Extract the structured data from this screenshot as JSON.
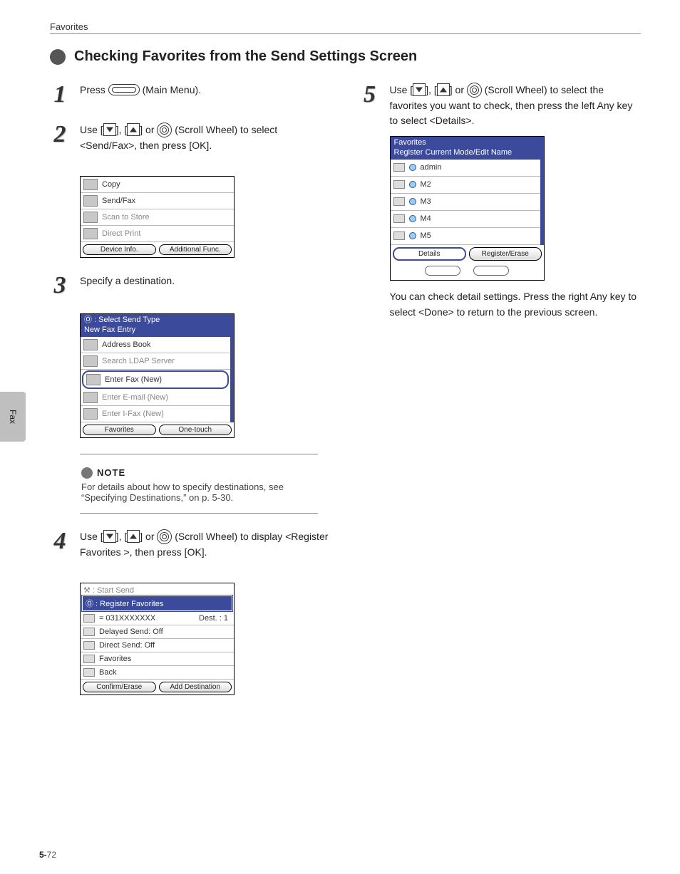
{
  "running_header": "Favorites",
  "section_title": "Checking Favorites from the Send Settings Screen",
  "sidetab": "Fax",
  "page_number_bold": "5-",
  "page_number_rest": "72",
  "steps": {
    "s1": {
      "num": "1",
      "text_a": "Press ",
      "text_b": " (Main Menu)."
    },
    "s2": {
      "num": "2",
      "text_a": "Use [",
      "text_b": "], [",
      "text_c": "] or ",
      "text_d": " (Scroll Wheel) to select <Send/Fax>, then press [OK]."
    },
    "s3": {
      "num": "3",
      "text": "Specify a destination."
    },
    "s4": {
      "num": "4",
      "text_a": "Use [",
      "text_b": "], [",
      "text_c": "] or ",
      "text_d": " (Scroll Wheel) to display <Register Favorites >, then press [OK]."
    },
    "s5": {
      "num": "5",
      "text_a": "Use [",
      "text_b": "], [",
      "text_c": "] or ",
      "text_d": " (Scroll Wheel) to select the favorites you want to check, then press the left Any key to select <Details>.",
      "below_text": "You can check detail settings. Press the right Any key to select <Done> to return to the previous screen."
    }
  },
  "note": {
    "label": "NOTE",
    "text": "For details about how to specify destinations, see “Specifying Destinations,” on p. 5-30."
  },
  "lcd2": {
    "row1": "Copy",
    "row2": "Send/Fax",
    "row3": "Scan to Store",
    "row4": "Direct Print",
    "btn_left": "Device Info.",
    "btn_right": "Additional Func."
  },
  "lcd3": {
    "hdr1": "Ⓞ : Select Send Type",
    "hdr2": "New Fax Entry",
    "r1": "Address Book",
    "r2": "Search LDAP Server",
    "r3": "Enter Fax (New)",
    "r4": "Enter E-mail (New)",
    "r5": "Enter I-Fax (New)",
    "btn_left": "Favorites",
    "btn_right": "One-touch"
  },
  "lcd4": {
    "top": "⚒ : Start Send",
    "hl": "Ⓞ : Register Favorites",
    "dest_label": "= 031XXXXXXX",
    "dest_count": "Dest.  : 1",
    "r1": "Delayed Send: Off",
    "r2": "Direct Send: Off",
    "r3": "Favorites",
    "r4": "Back",
    "btn_left": "Confirm/Erase",
    "btn_right": "Add Destination"
  },
  "lcd5": {
    "hdr1": "Favorites",
    "hdr2": "Register Current Mode/Edit Name",
    "r1": "admin",
    "r2": "M2",
    "r3": "M3",
    "r4": "M4",
    "r5": "M5",
    "btn_left": "Details",
    "btn_right": "Register/Erase"
  }
}
